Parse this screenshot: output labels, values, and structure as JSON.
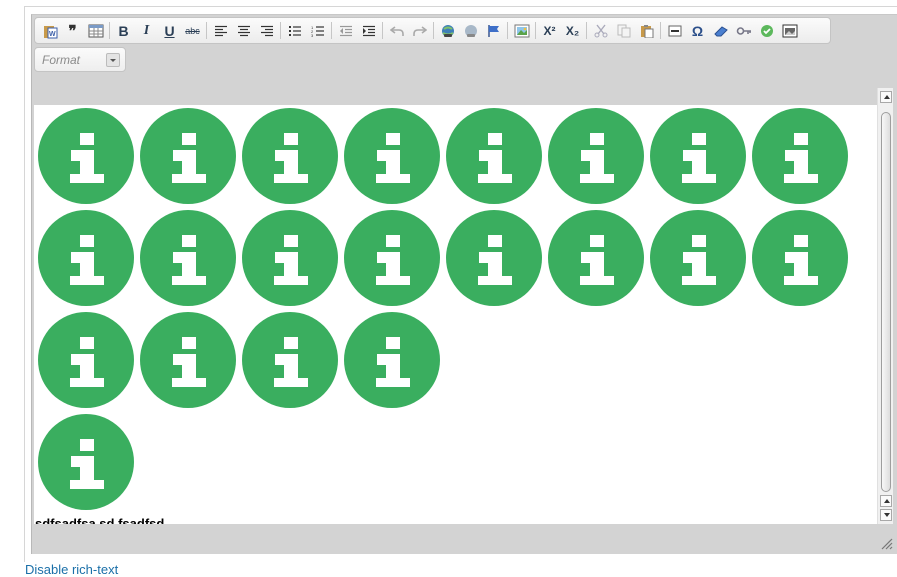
{
  "toolbar": {
    "buttons": [
      {
        "name": "paste-from-word-icon"
      },
      {
        "name": "blockquote-icon",
        "label": "❞"
      },
      {
        "name": "table-icon"
      },
      {
        "name": "bold-icon",
        "label": "B"
      },
      {
        "name": "italic-icon",
        "label": "I"
      },
      {
        "name": "underline-icon",
        "label": "U"
      },
      {
        "name": "strikethrough-icon",
        "label": "abc"
      },
      {
        "name": "align-left-icon"
      },
      {
        "name": "align-center-icon"
      },
      {
        "name": "align-right-icon"
      },
      {
        "name": "bulleted-list-icon"
      },
      {
        "name": "numbered-list-icon"
      },
      {
        "name": "outdent-icon"
      },
      {
        "name": "indent-icon"
      },
      {
        "name": "undo-icon"
      },
      {
        "name": "redo-icon"
      },
      {
        "name": "link-icon"
      },
      {
        "name": "unlink-icon"
      },
      {
        "name": "anchor-flag-icon"
      },
      {
        "name": "image-icon"
      },
      {
        "name": "superscript-icon",
        "label": "X²"
      },
      {
        "name": "subscript-icon",
        "label": "X₂"
      },
      {
        "name": "cut-icon"
      },
      {
        "name": "copy-icon"
      },
      {
        "name": "paste-icon"
      },
      {
        "name": "horizontal-rule-icon"
      },
      {
        "name": "special-character-icon",
        "label": "Ω"
      },
      {
        "name": "remove-format-icon"
      },
      {
        "name": "key-icon"
      },
      {
        "name": "check-icon"
      },
      {
        "name": "media-embed-icon"
      }
    ]
  },
  "format": {
    "label": "Format"
  },
  "content": {
    "icon_rows": [
      8,
      8,
      4,
      1
    ],
    "icon_name": "info-icon",
    "icon_color": "#3aae5f",
    "bottom_text": "sdfsadfsa sd fsadfsd"
  },
  "footer": {
    "disable_rich_text": "Disable rich-text"
  }
}
